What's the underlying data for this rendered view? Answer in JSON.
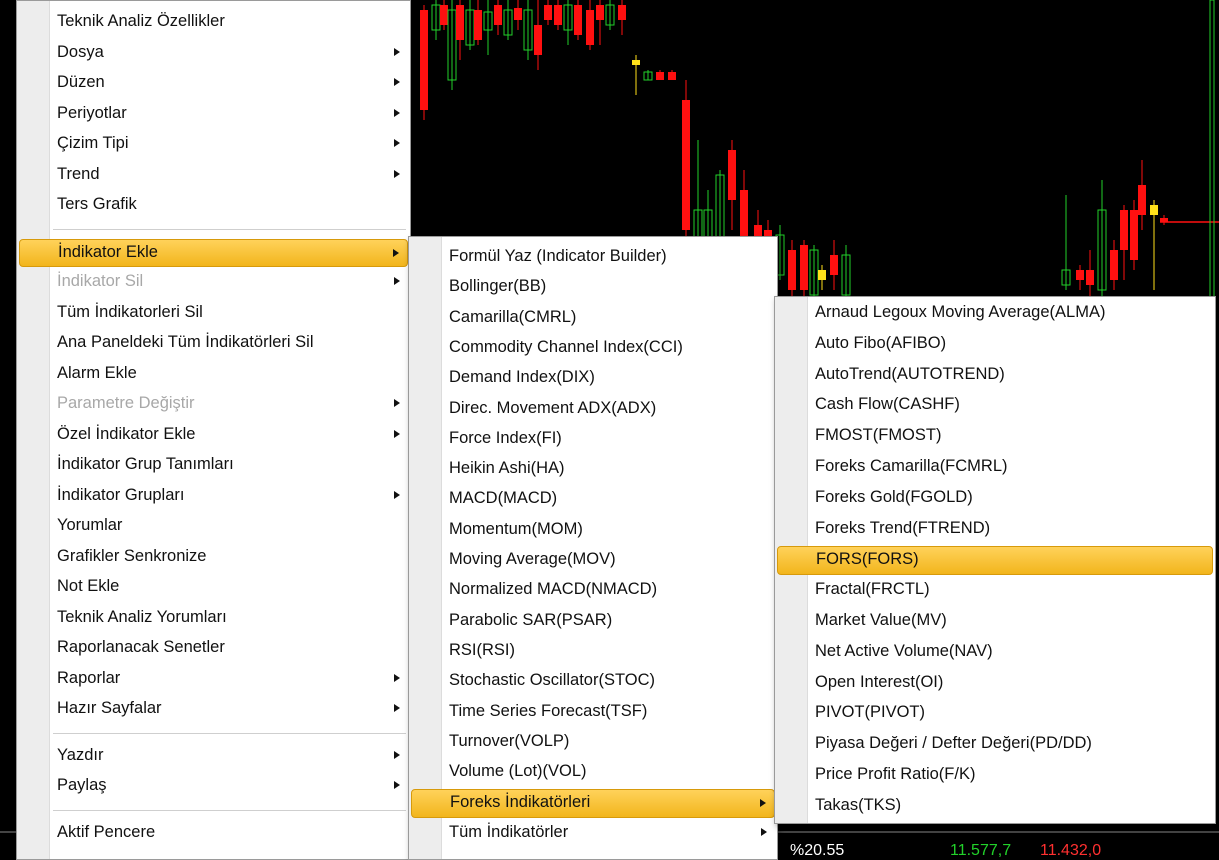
{
  "menu1": {
    "items": [
      {
        "label": "Teknik Analiz Özellikler",
        "arrow": false
      },
      {
        "label": "Dosya",
        "arrow": true
      },
      {
        "label": "Düzen",
        "arrow": true
      },
      {
        "label": "Periyotlar",
        "arrow": true
      },
      {
        "label": "Çizim Tipi",
        "arrow": true
      },
      {
        "label": "Trend",
        "arrow": true
      },
      {
        "label": "Ters Grafik",
        "arrow": false
      },
      {
        "sep": true
      },
      {
        "label": "İndikator Ekle",
        "arrow": true,
        "highlighted": true
      },
      {
        "label": "İndikator Sil",
        "arrow": true,
        "disabled": true
      },
      {
        "label": "Tüm İndikatorleri Sil",
        "arrow": false
      },
      {
        "label": "Ana Paneldeki Tüm İndikatörleri Sil",
        "arrow": false
      },
      {
        "label": "Alarm Ekle",
        "arrow": false
      },
      {
        "label": "Parametre Değiştir",
        "arrow": true,
        "disabled": true
      },
      {
        "label": "Özel İndikator Ekle",
        "arrow": true
      },
      {
        "label": "İndikator Grup Tanımları",
        "arrow": false
      },
      {
        "label": "İndikator Grupları",
        "arrow": true
      },
      {
        "label": "Yorumlar",
        "arrow": false
      },
      {
        "label": "Grafikler Senkronize",
        "arrow": false
      },
      {
        "label": "Not Ekle",
        "arrow": false
      },
      {
        "label": "Teknik Analiz Yorumları",
        "arrow": false
      },
      {
        "label": "Raporlanacak Senetler",
        "arrow": false
      },
      {
        "label": "Raporlar",
        "arrow": true
      },
      {
        "label": "Hazır Sayfalar",
        "arrow": true
      },
      {
        "sep": true
      },
      {
        "label": "Yazdır",
        "arrow": true
      },
      {
        "label": "Paylaş",
        "arrow": true
      },
      {
        "sep": true
      },
      {
        "label": "Aktif Pencere",
        "arrow": false
      }
    ]
  },
  "menu2": {
    "items": [
      {
        "label": "Formül Yaz (Indicator Builder)",
        "arrow": false
      },
      {
        "label": "Bollinger(BB)",
        "arrow": false
      },
      {
        "label": "Camarilla(CMRL)",
        "arrow": false
      },
      {
        "label": "Commodity Channel Index(CCI)",
        "arrow": false
      },
      {
        "label": "Demand Index(DIX)",
        "arrow": false
      },
      {
        "label": "Direc. Movement ADX(ADX)",
        "arrow": false
      },
      {
        "label": "Force Index(FI)",
        "arrow": false
      },
      {
        "label": "Heikin Ashi(HA)",
        "arrow": false
      },
      {
        "label": "MACD(MACD)",
        "arrow": false
      },
      {
        "label": "Momentum(MOM)",
        "arrow": false
      },
      {
        "label": "Moving Average(MOV)",
        "arrow": false
      },
      {
        "label": "Normalized MACD(NMACD)",
        "arrow": false
      },
      {
        "label": "Parabolic SAR(PSAR)",
        "arrow": false
      },
      {
        "label": "RSI(RSI)",
        "arrow": false
      },
      {
        "label": "Stochastic Oscillator(STOC)",
        "arrow": false
      },
      {
        "label": "Time Series Forecast(TSF)",
        "arrow": false
      },
      {
        "label": "Turnover(VOLP)",
        "arrow": false
      },
      {
        "label": "Volume (Lot)(VOL)",
        "arrow": false
      },
      {
        "label": "Foreks İndikatörleri",
        "arrow": true,
        "highlighted": true
      },
      {
        "label": "Tüm İndikatörler",
        "arrow": true
      }
    ]
  },
  "menu3": {
    "items": [
      {
        "label": "Arnaud Legoux Moving Average(ALMA)",
        "arrow": false
      },
      {
        "label": "Auto Fibo(AFIBO)",
        "arrow": false
      },
      {
        "label": "AutoTrend(AUTOTREND)",
        "arrow": false
      },
      {
        "label": "Cash Flow(CASHF)",
        "arrow": false
      },
      {
        "label": "FMOST(FMOST)",
        "arrow": false
      },
      {
        "label": "Foreks Camarilla(FCMRL)",
        "arrow": false
      },
      {
        "label": "Foreks Gold(FGOLD)",
        "arrow": false
      },
      {
        "label": "Foreks Trend(FTREND)",
        "arrow": false
      },
      {
        "label": "FORS(FORS)",
        "arrow": false,
        "highlighted": true
      },
      {
        "label": "Fractal(FRCTL)",
        "arrow": false
      },
      {
        "label": "Market Value(MV)",
        "arrow": false
      },
      {
        "label": "Net Active Volume(NAV)",
        "arrow": false
      },
      {
        "label": "Open Interest(OI)",
        "arrow": false
      },
      {
        "label": "PIVOT(PIVOT)",
        "arrow": false
      },
      {
        "label": "Piyasa Değeri / Defter Değeri(PD/DD)",
        "arrow": false
      },
      {
        "label": "Price Profit Ratio(F/K)",
        "arrow": false
      },
      {
        "label": "Takas(TKS)",
        "arrow": false
      }
    ]
  },
  "bottom": {
    "pct": "%20.55",
    "v1": "11.577,7",
    "v2": "11.432,0"
  },
  "colors": {
    "up": "#22d12a",
    "down": "#ff1010",
    "highlight": "#f5bd27"
  }
}
